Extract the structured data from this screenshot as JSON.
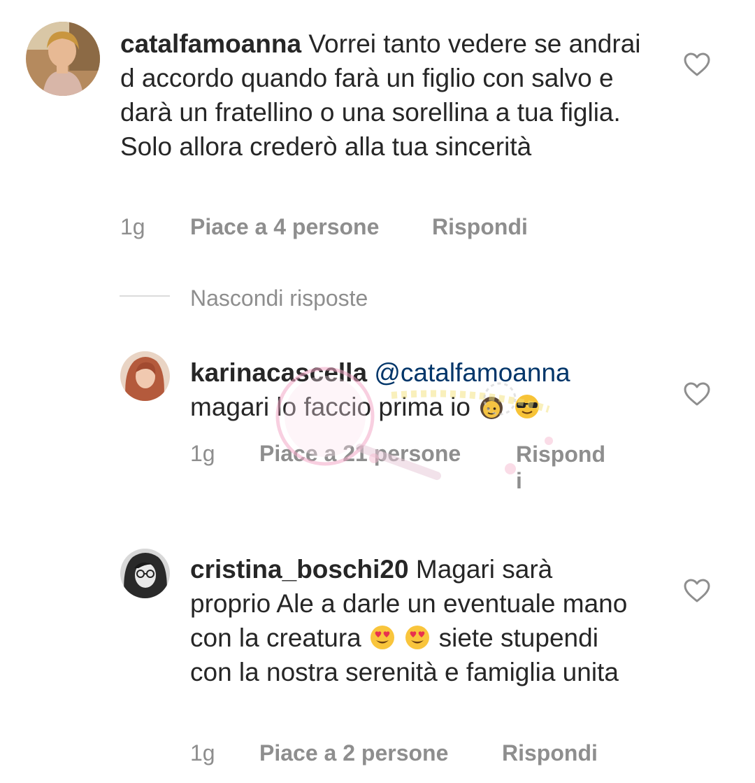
{
  "comments": [
    {
      "username": "catalfamoanna",
      "text": "Vorrei tanto vedere se andrai d accordo quando farà un figlio con salvo e darà un fratellino o una sorellina a tua figlia. Solo allora crederò alla tua sincerità",
      "time": "1g",
      "likes": "Piace a 4 persone",
      "reply": "Rispondi",
      "avatar_icon": "profile-photo-woman",
      "like_icon": "heart-outline-icon"
    }
  ],
  "replies_toggle": "Nascondi risposte",
  "replies": [
    {
      "username": "karinacascella",
      "mention": "@catalfamoanna",
      "text": "magari lo faccio prima io",
      "emojis": [
        "woman-emoji",
        "sunglasses-emoji"
      ],
      "time": "1g",
      "likes": "Piace a 21 persone",
      "reply_line1": "Rispond",
      "reply_line2": "i",
      "avatar_icon": "profile-photo-woman-red-hair",
      "like_icon": "heart-outline-icon"
    },
    {
      "username": "cristina_boschi20",
      "text_a": "Magari sarà proprio Ale a darle un eventuale mano con la creatura",
      "emojis": [
        "heart-eyes-emoji",
        "heart-eyes-emoji"
      ],
      "text_b": "siete stupendi con la nostra serenità e famiglia unita",
      "time": "1g",
      "likes": "Piace a 2 persone",
      "reply": "Rispondi",
      "avatar_icon": "profile-photo-woman-glasses",
      "like_icon": "heart-outline-icon"
    }
  ],
  "colors": {
    "text": "#262626",
    "meta": "#8e8e8e",
    "mention": "#003569",
    "divider": "#dbdbdb"
  }
}
